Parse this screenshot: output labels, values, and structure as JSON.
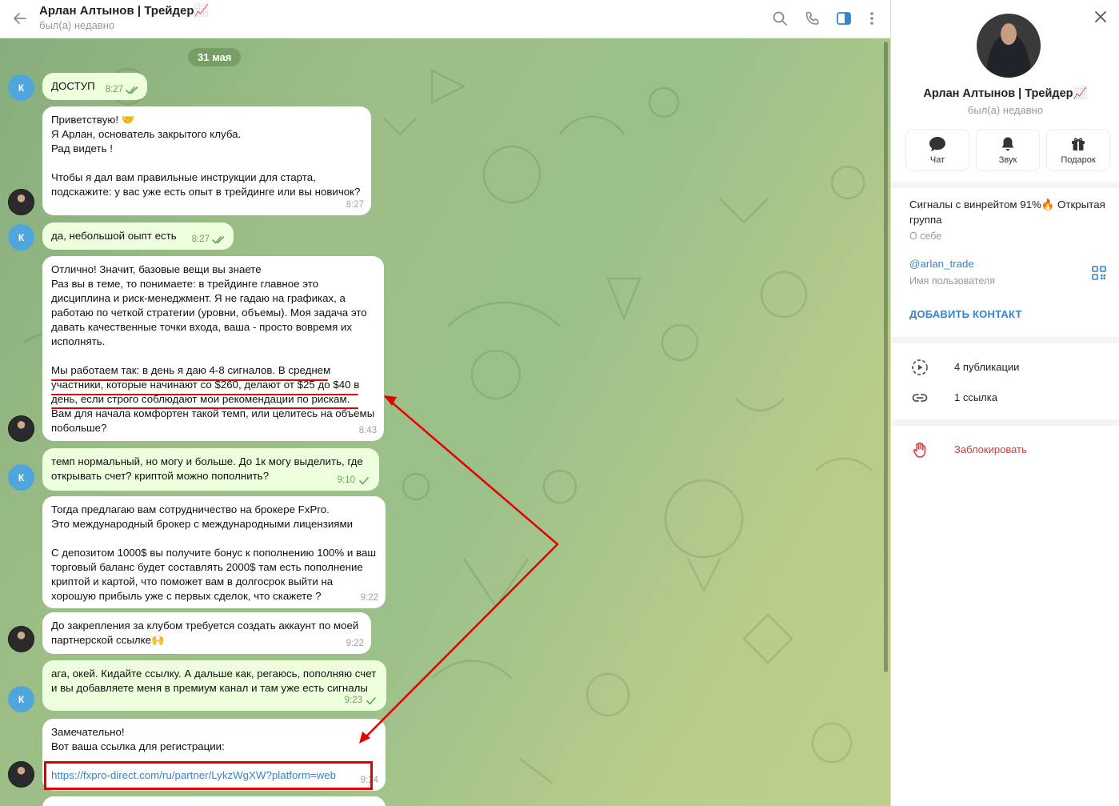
{
  "chat": {
    "title": "Арлан Алтынов | Трейдер📈",
    "status": "был(а) недавно",
    "date_label": "31 мая",
    "messages": [
      {
        "text": "ДОСТУП",
        "time": "8:27"
      },
      {
        "text": "Приветствую! 🤝\nЯ Арлан, основатель закрытого клуба.\nРад видеть !\n\nЧтобы я дал вам правильные инструкции для старта, подскажите: у вас уже есть опыт в трейдинге или вы новичок?",
        "time": "8:27"
      },
      {
        "text": "да, небольшой оыпт есть",
        "time": "8:27"
      },
      {
        "text": "Отлично! Значит, базовые вещи вы знаете\nРаз вы в теме, то понимаете: в трейдинге главное это дисциплина и риск-менеджмент. Я не гадаю на графиках, а работаю по четкой стратегии (уровни, объемы). Моя задача это давать качественные точки входа, ваша - просто вовремя их исполнять.\n\nМы работаем так: в день я даю 4-8 сигналов. В среднем участники, которые начинают со $260, делают от $25 до $40 в день, если строго соблюдают мои рекомендации по рискам.\nВам для начала комфортен такой темп, или целитесь на объемы побольше?",
        "time": "8:43"
      },
      {
        "text": "темп нормальный, но могу и больше. До 1к могу выделить, где открывать счет? криптой можно пополнить?",
        "time": "9:10"
      },
      {
        "text": "Тогда предлагаю вам сотрудничество на брокере FxPro.\nЭто международный брокер с международными лицензиями\n\nС депозитом 1000$ вы получите бонус к пополнению 100% и ваш торговый баланс будет составлять 2000$ там есть пополнение криптой и картой, что поможет вам в долгосрок выйти на хорошую прибыль уже с первых сделок, что скажете ?",
        "time": "9:22"
      },
      {
        "text": "До закрепления за клубом требуется создать аккаунт по моей партнерской ссылке🙌",
        "time": "9:22"
      },
      {
        "text": "ага, окей. Кидайте ссылку. А дальше как, регаюсь, пополняю счет и вы добавляете меня в премиум канал и там уже есть сигналы",
        "time": "9:23"
      },
      {
        "text": "Замечательно!\nВот ваша ссылка для регистрации:",
        "link": "https://fxpro-direct.com/ru/partner/LykzWgXW?platform=web",
        "time": "9:24"
      }
    ],
    "avatar_letter": "К"
  },
  "panel": {
    "name": "Арлан Алтынов | Трейдер📈",
    "status": "был(а) недавно",
    "actions": [
      "Чат",
      "Звук",
      "Подарок"
    ],
    "about": "Сигналы с винрейтом 91%🔥 Открытая группа",
    "about_label": "О себе",
    "username": "@arlan_trade",
    "username_label": "Имя пользователя",
    "add_contact": "ДОБАВИТЬ КОНТАКТ",
    "publications": "4 публикации",
    "links": "1 ссылка",
    "block": "Заблокировать"
  },
  "colors": {
    "incoming_bubble": "#ffffff",
    "outgoing_bubble": "#eeffde",
    "accent": "#3a83c4",
    "annotation_red": "#e40000",
    "block_red": "#d23939"
  }
}
